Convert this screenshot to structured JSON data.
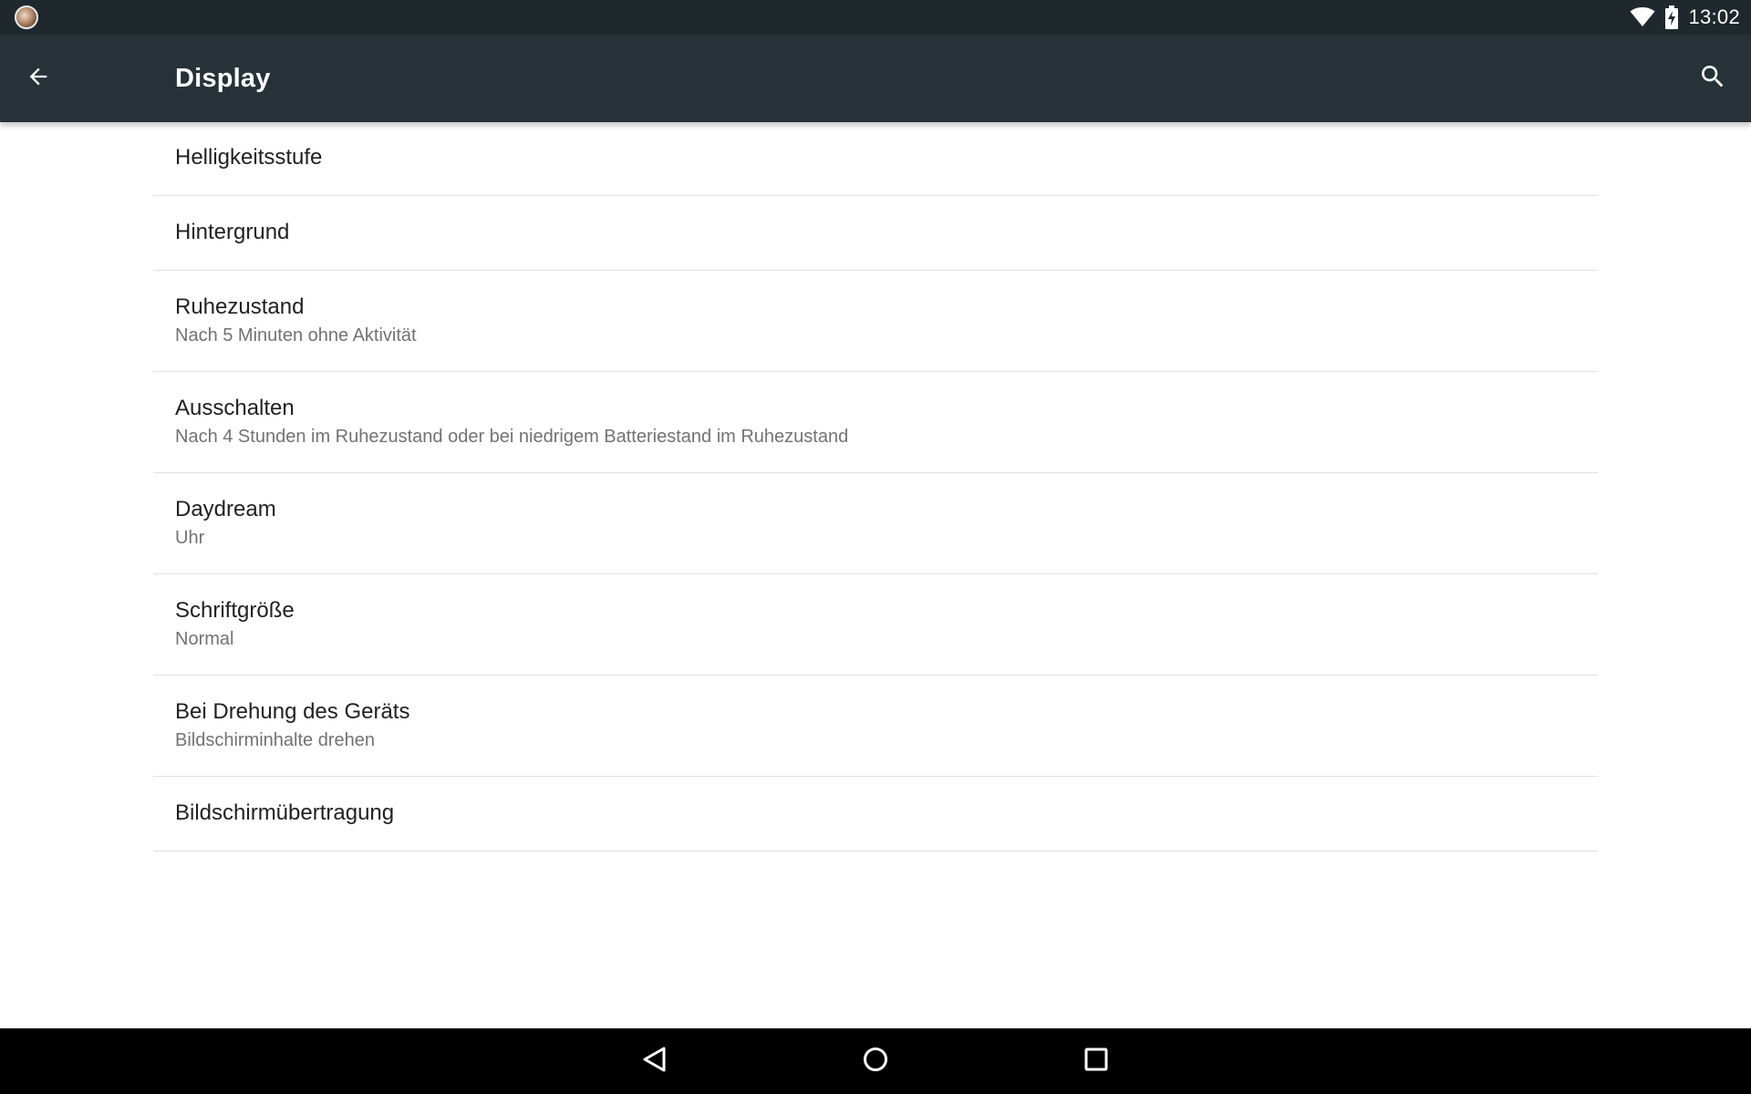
{
  "status_bar": {
    "time": "13:02",
    "icons": [
      "app-notification-icon",
      "wifi-icon",
      "battery-charging-icon"
    ]
  },
  "app_bar": {
    "title": "Display",
    "back_icon": "arrow-back-icon",
    "search_icon": "search-icon",
    "background_color": "#263238"
  },
  "settings": {
    "items": [
      {
        "title": "Helligkeitsstufe",
        "summary": ""
      },
      {
        "title": "Hintergrund",
        "summary": ""
      },
      {
        "title": "Ruhezustand",
        "summary": "Nach 5 Minuten ohne Aktivität"
      },
      {
        "title": "Ausschalten",
        "summary": "Nach 4 Stunden im Ruhezustand oder bei niedrigem Batteriestand im Ruhezustand"
      },
      {
        "title": "Daydream",
        "summary": "Uhr"
      },
      {
        "title": "Schriftgröße",
        "summary": "Normal"
      },
      {
        "title": "Bei Drehung des Geräts",
        "summary": "Bildschirminhalte drehen"
      },
      {
        "title": "Bildschirmübertragung",
        "summary": ""
      }
    ]
  },
  "nav_bar": {
    "icons": [
      "nav-back-icon",
      "nav-home-icon",
      "nav-recents-icon"
    ]
  }
}
